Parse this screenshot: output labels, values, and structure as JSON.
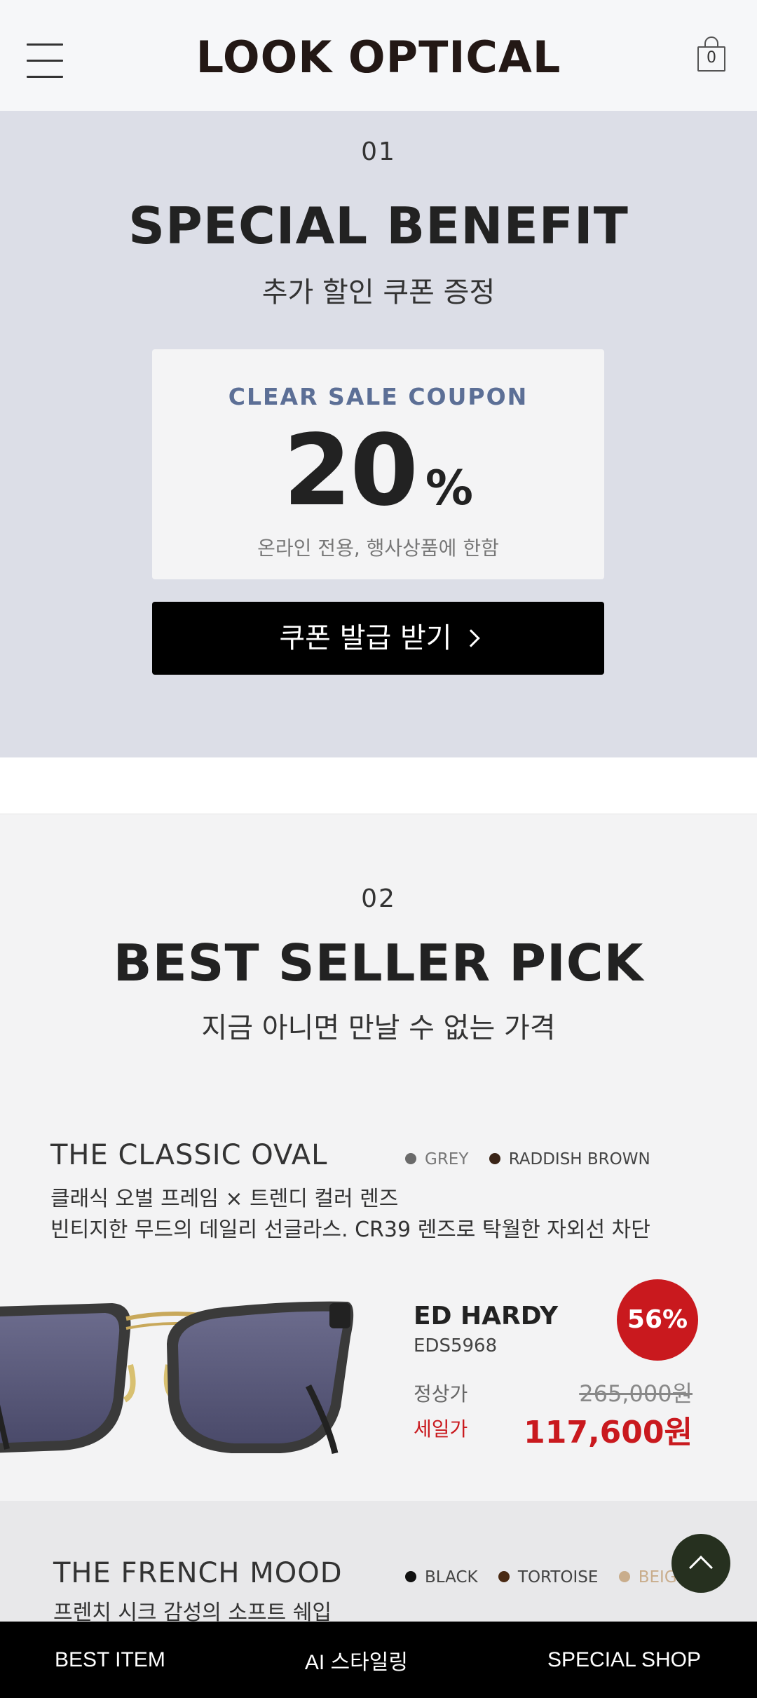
{
  "header": {
    "logo": "LOOK OPTICAL",
    "cart_count": "0"
  },
  "benefit": {
    "number": "01",
    "title": "SPECIAL BENEFIT",
    "subtitle": "추가 할인 쿠폰 증정",
    "coupon_label": "CLEAR SALE COUPON",
    "coupon_value": "20",
    "coupon_unit": "%",
    "coupon_note": "온라인 전용, 행사상품에 한함",
    "button_label": "쿠폰 발급 받기"
  },
  "bestseller": {
    "number": "02",
    "title": "BEST SELLER PICK",
    "subtitle": "지금 아니면 만날 수 없는 가격",
    "products": [
      {
        "title": "THE CLASSIC OVAL",
        "colors": [
          {
            "name": "GREY",
            "hex": "#6a6a6a"
          },
          {
            "name": "RADDISH BROWN",
            "hex": "#3a2417"
          }
        ],
        "desc_line1": "클래식 오벌 프레임 × 트렌디 컬러 렌즈",
        "desc_line2": "빈티지한 무드의 데일리 선글라스.  CR39 렌즈로 탁월한 자외선 차단",
        "brand": "ED HARDY",
        "model": "EDS5968",
        "discount": "56%",
        "original_label": "정상가",
        "original_price": "265,000원",
        "sale_label": "세일가",
        "sale_price": "117,600원"
      },
      {
        "title": "THE FRENCH MOOD",
        "colors": [
          {
            "name": "BLACK",
            "hex": "#111111"
          },
          {
            "name": "TORTOISE",
            "hex": "#4a2a14"
          },
          {
            "name": "BEIGE",
            "hex": "#c9ad8c"
          }
        ],
        "desc_line1": "프렌치 시크 감성의 소프트 쉐입"
      }
    ]
  },
  "bottom_nav": {
    "items": [
      "BEST ITEM",
      "AI 스타일링",
      "SPECIAL SHOP"
    ]
  },
  "colors": {
    "accent_red": "#c9191e",
    "coupon_blue": "#5c6f96",
    "benefit_bg": "#dcdee7",
    "scroll_top_bg": "#26301f"
  }
}
